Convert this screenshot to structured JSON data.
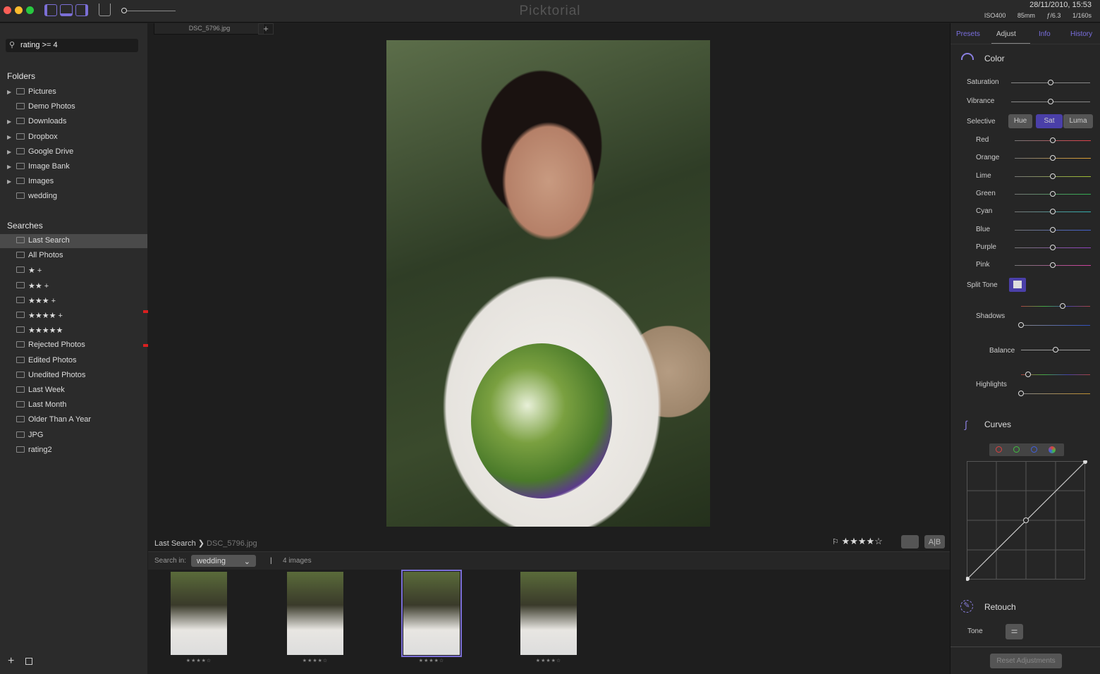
{
  "app": {
    "title": "Picktorial"
  },
  "meta": {
    "datetime": "28/11/2010, 15:53",
    "iso": "ISO400",
    "focal": "85mm",
    "aperture": "ƒ/6.3",
    "shutter": "1/160s"
  },
  "tab": {
    "label": "DSC_5796.jpg",
    "add": "+"
  },
  "search": {
    "value": "rating >= 4"
  },
  "folders": {
    "title": "Folders",
    "items": [
      {
        "label": "Pictures",
        "expand": true
      },
      {
        "label": "Demo Photos",
        "expand": false
      },
      {
        "label": "Downloads",
        "expand": true
      },
      {
        "label": "Dropbox",
        "expand": true
      },
      {
        "label": "Google Drive",
        "expand": true
      },
      {
        "label": "Image Bank",
        "expand": true
      },
      {
        "label": "Images",
        "expand": true
      },
      {
        "label": "wedding",
        "expand": false
      }
    ]
  },
  "searches": {
    "title": "Searches",
    "items": [
      "Last Search",
      "All Photos",
      "★ +",
      "★★ +",
      "★★★ +",
      "★★★★ +",
      "★★★★★",
      "Rejected Photos",
      "Edited Photos",
      "Unedited Photos",
      "Last Week",
      "Last Month",
      "Older Than A Year",
      "JPG",
      "rating2"
    ],
    "selected": "Last Search"
  },
  "breadcrumb": {
    "parent": "Last Search",
    "sep": "❯",
    "current": "DSC_5796.jpg"
  },
  "viewer": {
    "rating": 4,
    "stars": "★★★★",
    "empty_star": "☆",
    "compare": "A|B"
  },
  "filmstrip": {
    "search_in_label": "Search in:",
    "search_in_value": "wedding",
    "sep": "|",
    "count": "4 images",
    "thumbs": [
      {
        "stars": "★★★★☆",
        "selected": false
      },
      {
        "stars": "★★★★☆",
        "selected": false
      },
      {
        "stars": "★★★★☆",
        "selected": true
      },
      {
        "stars": "★★★★☆",
        "selected": false
      }
    ]
  },
  "right": {
    "tabs": [
      "Presets",
      "Adjust",
      "Info",
      "History"
    ],
    "active_tab": "Adjust",
    "color": {
      "title": "Color",
      "saturation": {
        "label": "Saturation",
        "value": 0.5
      },
      "vibrance": {
        "label": "Vibrance",
        "value": 0.5
      },
      "selective": {
        "label": "Selective",
        "modes": [
          "Hue",
          "Sat",
          "Luma"
        ],
        "active": "Sat"
      },
      "channels": [
        {
          "label": "Red",
          "color": "#e0404a",
          "value": 0.5
        },
        {
          "label": "Orange",
          "color": "#e0a030",
          "value": 0.5
        },
        {
          "label": "Lime",
          "color": "#a0c030",
          "value": 0.5
        },
        {
          "label": "Green",
          "color": "#30b050",
          "value": 0.5
        },
        {
          "label": "Cyan",
          "color": "#30b0b0",
          "value": 0.5
        },
        {
          "label": "Blue",
          "color": "#4060d0",
          "value": 0.5
        },
        {
          "label": "Purple",
          "color": "#9040c0",
          "value": 0.5
        },
        {
          "label": "Pink",
          "color": "#d040a0",
          "value": 0.5
        }
      ],
      "split_tone": {
        "label": "Split Tone",
        "shadows": "Shadows",
        "balance": "Balance",
        "highlights": "Highlights",
        "shadows_hue": 0.6,
        "shadows_amount": 0,
        "balance_value": 0.5,
        "highlights_hue": 0.1,
        "highlights_amount": 0
      }
    },
    "curves": {
      "title": "Curves"
    },
    "retouch": {
      "title": "Retouch",
      "tone": "Tone"
    },
    "reset": "Reset Adjustments"
  },
  "colors": {
    "accent": "#6b5fd6"
  }
}
